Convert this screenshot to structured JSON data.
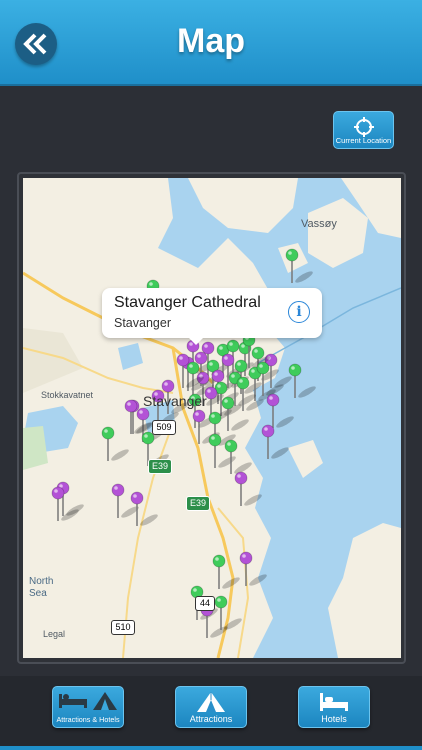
{
  "header": {
    "title": "Map",
    "back_icon": "double-chevron-left-icon"
  },
  "current_location": {
    "label": "Current Location",
    "icon": "crosshair-icon"
  },
  "map": {
    "callout": {
      "title": "Stavanger Cathedral",
      "subtitle": "Stavanger",
      "info_icon": "info-icon"
    },
    "place_labels": {
      "vassoy": "Vassøy",
      "stokkavatnet": "Stokkavatnet",
      "stavanger": "Stavanger",
      "north_sea": "North\nSea",
      "legal": "Legal"
    },
    "road_labels": {
      "r509": "509",
      "e39_a": "E39",
      "e39_b": "E39",
      "r44": "44",
      "r510": "510"
    },
    "pin_colors": {
      "attraction": "#b352d6",
      "hotel": "#3fcc5b"
    }
  },
  "tabs": [
    {
      "label": "Attractions & Hotels",
      "icon": "bed-and-tent-icon"
    },
    {
      "label": "Attractions",
      "icon": "tent-icon"
    },
    {
      "label": "Hotels",
      "icon": "bed-icon"
    }
  ],
  "colors": {
    "header": "#2a9fd8",
    "accent": "#1f8fc9",
    "background": "#2c2f36"
  }
}
